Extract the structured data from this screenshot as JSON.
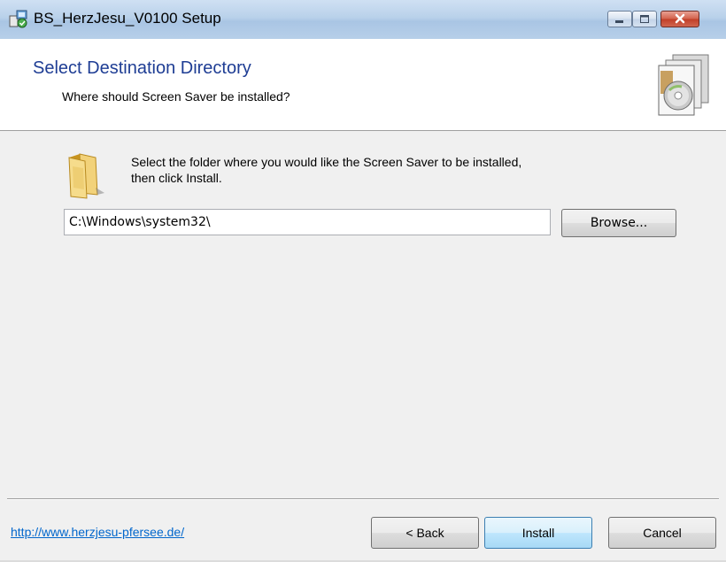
{
  "window": {
    "title": "BS_HerzJesu_V0100 Setup",
    "controls": {
      "minimize": "minimize",
      "maximize": "maximize",
      "close": "close"
    }
  },
  "header": {
    "title": "Select Destination Directory",
    "subtitle": "Where should Screen Saver be installed?",
    "icon": "installer-disc-icon"
  },
  "main": {
    "folder_icon": "folder-icon",
    "instruction_line1": "Select the folder where you would like the Screen Saver to be installed,",
    "instruction_line2": "then click Install.",
    "path_value": "C:\\Windows\\system32\\",
    "browse_label": "Browse..."
  },
  "footer": {
    "link_text": "http://www.herzjesu-pfersee.de/",
    "back_label": "< Back",
    "install_label": "Install",
    "cancel_label": "Cancel"
  },
  "colors": {
    "header_title": "#1e3d94",
    "link": "#0066cc",
    "close_button": "#c13e27",
    "titlebar": "#b9d1ea"
  }
}
